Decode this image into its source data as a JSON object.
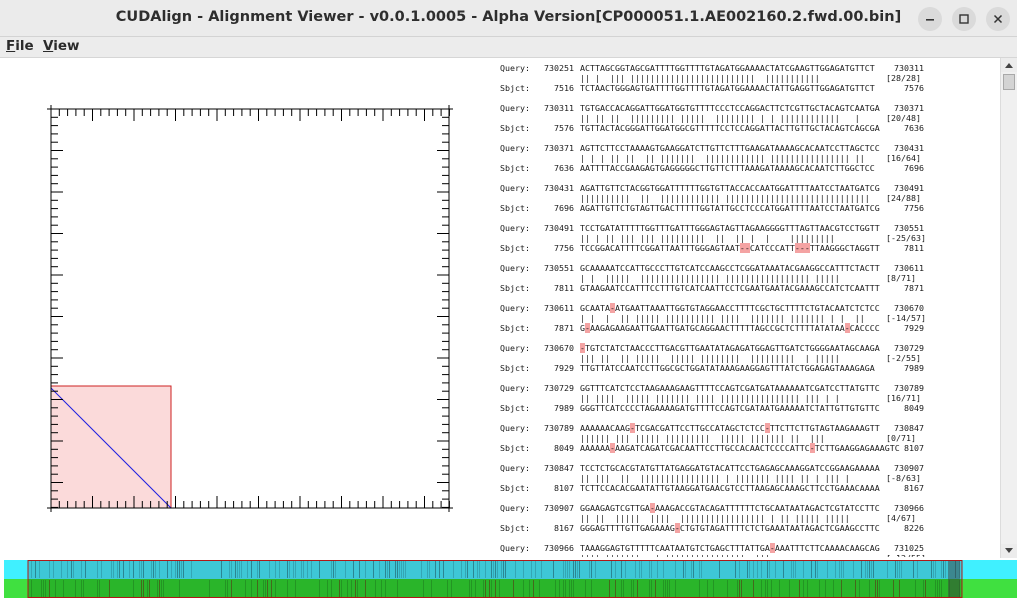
{
  "window": {
    "title": "CUDAlign - Alignment Viewer - v0.0.1.0005 - Alpha Version[CP000051.1.AE002160.2.fwd.00.bin]"
  },
  "menu": {
    "items": [
      "File",
      "View"
    ]
  },
  "labels": {
    "query": "Query:",
    "sbjct": "Sbjct:"
  },
  "colors": {
    "highlight": "#fbdada",
    "highlight_border": "#cc2222",
    "diagonal": "#1f1fe0",
    "strip_top": "#3ec7d6",
    "strip_bottom": "#2ab52a",
    "gap": "#f4a3a3"
  },
  "alignments": [
    {
      "q_start": "730251",
      "q_seq": "ACTTAGCGGTAGCGATTTTGGTTTTGTAGATGGAAAACTATCGAAGTTGGAGATGTTCT",
      "q_end": "730311",
      "bars": "|| |  ||| |||||||||||||||||||||||||  |||||||||||",
      "score": "[28/28]",
      "s_start": "7516",
      "s_seq": "TCTAACTGGGAGTGATTTTGGTTTTGTAGATGGAAAACTATTGAGGTTGGAGATGTTCT",
      "s_end": "7576"
    },
    {
      "q_start": "730311",
      "q_seq": "TGTGACCACAGGATTGGATGGTGTTTTCCCTCCAGGACTTCTCGTTGCTACAGTCAATGA",
      "q_end": "730371",
      "bars": "|| || ||  ||||||||| |||||  |||||||| | | ||||||||||||   |",
      "score": "[20/48]",
      "s_start": "7576",
      "s_seq": "TGTTACTACGGGATTGGATGGCGTTTTTCCTCCAGGATTACTTGTTGCTACAGTCAGCGA",
      "s_end": "7636"
    },
    {
      "q_start": "730371",
      "q_seq": "AGTTCTTCCTAAAAGTGAAGGATCTTGTTCTTTGAAGATAAAAGCACAATCCTTAGCTCC",
      "q_end": "730431",
      "bars": "| | | || ||  || |||||||  |||||||||||| |||||||||||||||| ||",
      "score": "[16/64]",
      "s_start": "7636",
      "s_seq": "AATTTTACCGAAGAGTGAGGGGGCTTGTTCTTTAAAGATAAAAGCACAATCTTGGCTCC",
      "s_end": "7696"
    },
    {
      "q_start": "730431",
      "q_seq": "AGATTGTTCTACGGTGGATTTTTTGGTGTTACCACCAATGGATTTTAATCCTAATGATCG",
      "q_end": "730491",
      "bars": "||||||||||  ||  |||||||||||| |||||||||||||||||||||||||||||",
      "score": "[24/88]",
      "s_start": "7696",
      "s_seq": "AGATTGTTCTGTAGTTGACTTTTTGGTATTGCCTCCCATGGATTTTAATCCTAATGATCG",
      "s_end": "7756"
    },
    {
      "q_start": "730491",
      "q_seq": "TCCTGATATTTTTGGTTTGATTTGGGAGTAGTTAGAAGGGGTTTAGTTAACGTCCTGGTT",
      "q_end": "730551",
      "bars": "|| | || ||| ||| |||||||||  ||  || |  |    |||||||||",
      "score": "[-25/63]",
      "s_start": "7756",
      "s_seq": "TCCGGACATTTTCGGATTAATTTGGGAGTAAT--CATCCCATT---TTAAGGGCTAGGTT",
      "s_end": "7811"
    },
    {
      "q_start": "730551",
      "q_seq": "GCAAAAATCCATTGCCCTTGTCATCCAAGCCTCGGATAAATACGAAGGCCATTTCTACTT",
      "q_end": "730611",
      "bars": "| |  |||||  |||||||||||||||| ||||||||||||||||| |||||",
      "score": "[8/71]",
      "s_start": "7811",
      "s_seq": "GTAAGAATCCATTTCCTTTGTCATCAATTCCTCGAATGAATACGAAAGCCATCTCAATTT",
      "s_end": "7871"
    },
    {
      "q_start": "730611",
      "q_seq": "GCAATA-ATGAATTAAATTGGTGTAGGAACCTTTTCGCTGCTTTTCTGTACAATCTCTCC",
      "q_end": "730670",
      "bars": "| |  |  || ||||| |||||||||| ||||  ||||||| ||||||| | |  ||",
      "score": "[-14/57]",
      "s_start": "7871",
      "s_seq": "G-AAGAGAAGAATTGAATTGATGCAGGAACTTTTTAGCCGCTCTTTTATATAA-CACCCC",
      "s_end": "7929"
    },
    {
      "q_start": "730670",
      "q_seq": "-TGTCTATCTAACCCTTGACGTTGAATATAGAGATGGAGTTGATCTGGGGAATAGCAAGA",
      "q_end": "730729",
      "bars": "||| ||  || |||||  ||||| ||||||||  |||||||||  | |||||",
      "score": "[-2/55]",
      "s_start": "7929",
      "s_seq": "TTGTTATCCAATCCTTGGCGCTGGATATAAAGAAGGAGTTTATCTGGAGAGTAAAGAGA",
      "s_end": "7989"
    },
    {
      "q_start": "730729",
      "q_seq": "GGTTTCATCTCCTAAGAAAGAAGTTTTCCAGTCGATGATAAAAAATCGATCCTTATGTTC",
      "q_end": "730789",
      "bars": "|| ||||  ||||| ||||||| |||| |||||||||||||||| ||| | |",
      "score": "[16/71]",
      "s_start": "7989",
      "s_seq": "GGGTTCATCCCCTAGAAAAGATGTTTTCCAGTCGATAATGAAAAATCTATTGTTGTGTTC",
      "s_end": "8049"
    },
    {
      "q_start": "730789",
      "q_seq": "AAAAAACAAG-TCGACGATTCCTTGCCATAGCTCTCC-TTCTTCTTGTAGTAAGAAAGTT",
      "q_end": "730847",
      "bars": "|||||| ||| ||||| |||||||||  ||||| ||||||| ||  |||",
      "score": "[0/71]",
      "s_start": "8049",
      "s_seq": "AAAAAA-AAGATCAGATCGACAATTCCTTGCCACAACTCCCCATTC-TCTTGAAGGAGAAAGTC",
      "s_end": "8107"
    },
    {
      "q_start": "730847",
      "q_seq": "TCCTCTGCACGTATGTTATGAGGATGTACATTCCTGAGAGCAAAGGATCCGGAAGAAAAA",
      "q_end": "730907",
      "bars": "|| |||  ||  |||||||||||||||| | ||||||| |||| || | ||| |",
      "score": "[-8/63]",
      "s_start": "8107",
      "s_seq": "TCTTCCACACGAATATTGTAAGGATGAACGTCCTTAAGAGCAAAGCTTCCTGAAACAAAA",
      "s_end": "8167"
    },
    {
      "q_start": "730907",
      "q_seq": "GGAAGAGTCGTTGA-AAAGACCGTACAGATTTTTTCTGCAATAATAGACTCGTATCCTTC",
      "q_end": "730966",
      "bars": "|| ||  |||||  ||||  ||||||||||||||||| | || ||||| |||||",
      "score": "[4/67]",
      "s_start": "8167",
      "s_seq": "GGGAGTTTTGTTGAGAAAG-CTGTGTAGATTTTCTCTGAAATAATAGACTCGAAGCCTTC",
      "s_end": "8226"
    },
    {
      "q_start": "730966",
      "q_seq": "TAAAGGAGTGTTTTTCAATAATGTCTGAGCTTTATTGA-AAATTTCTTCAAAACAAGCAG",
      "q_end": "731025",
      "bars": "|||| |||||||   | ||||||||||||||||  |||",
      "score": "[-12/55]",
      "s_start": "8226",
      "s_seq": "",
      "s_end": ""
    }
  ]
}
